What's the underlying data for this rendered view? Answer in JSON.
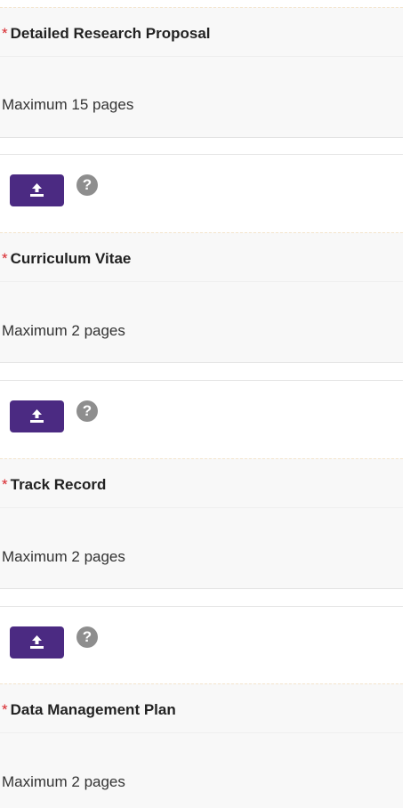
{
  "fields": [
    {
      "required_mark": "*",
      "title": "Detailed Research Proposal",
      "description": "Maximum 15 pages",
      "upload_icon": "upload-icon",
      "help_icon": "?"
    },
    {
      "required_mark": "*",
      "title": "Curriculum Vitae",
      "description": "Maximum 2 pages",
      "upload_icon": "upload-icon",
      "help_icon": "?"
    },
    {
      "required_mark": "*",
      "title": "Track Record",
      "description": "Maximum 2 pages",
      "upload_icon": "upload-icon",
      "help_icon": "?"
    },
    {
      "required_mark": "*",
      "title": "Data Management Plan",
      "description": "Maximum 2 pages"
    }
  ],
  "colors": {
    "accent": "#4b2a82",
    "required": "#d8262c",
    "panel_bg": "#f8f8f8",
    "help_icon": "#8e8e8e"
  }
}
